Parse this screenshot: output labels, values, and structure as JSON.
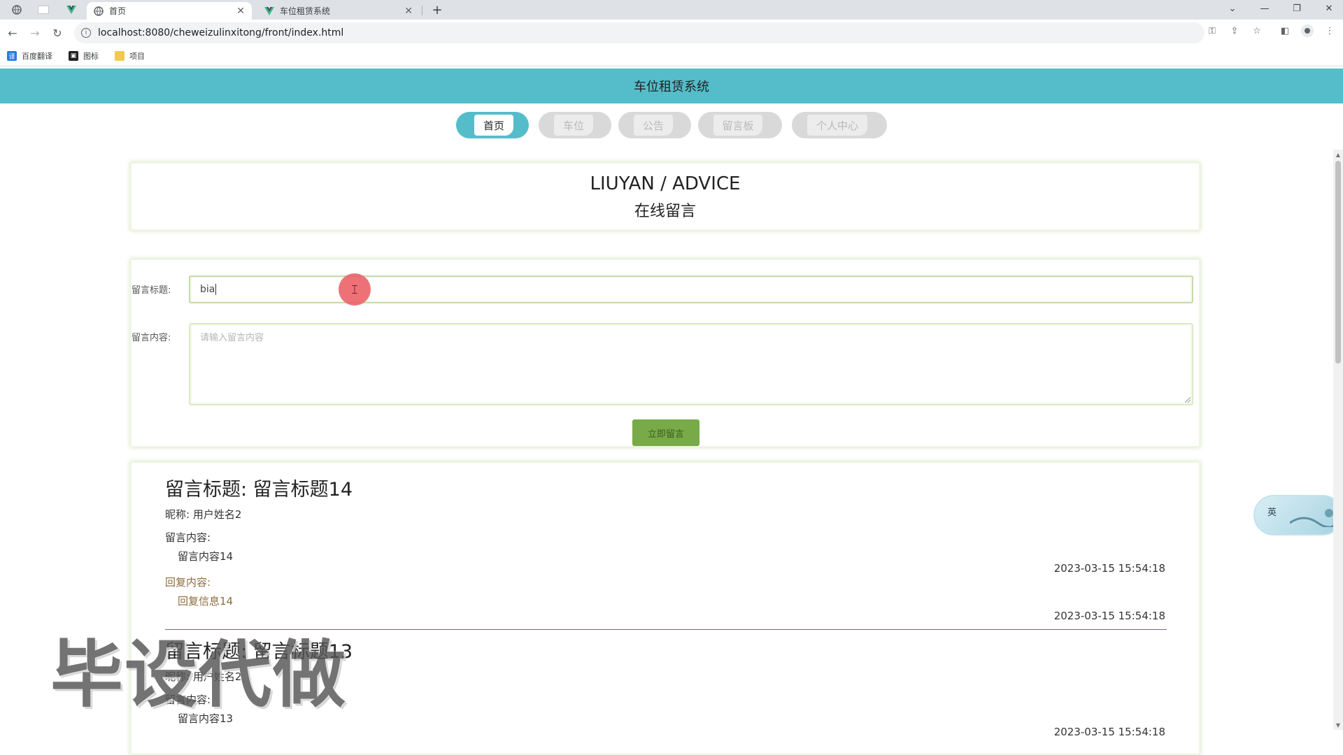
{
  "browser": {
    "tabs": [
      {
        "title": "首页",
        "active": true
      },
      {
        "title": "车位租赁系统",
        "active": false
      }
    ],
    "new_tab_label": "+",
    "url": "localhost:8080/cheweizulinxitong/front/index.html",
    "bookmarks": [
      {
        "label": "百度翻译",
        "icon": "translate-icon"
      },
      {
        "label": "图标",
        "icon": "image-icon"
      },
      {
        "label": "项目",
        "icon": "folder-icon"
      }
    ]
  },
  "site": {
    "title": "车位租赁系统",
    "nav": [
      {
        "label": "首页",
        "active": true
      },
      {
        "label": "车位",
        "active": false
      },
      {
        "label": "公告",
        "active": false
      },
      {
        "label": "留言板",
        "active": false
      },
      {
        "label": "个人中心",
        "active": false
      }
    ]
  },
  "section_header": {
    "en": "LIUYAN / ADVICE",
    "cn": "在线留言"
  },
  "form": {
    "title_label": "留言标题:",
    "title_value": "bia",
    "content_label": "留言内容:",
    "content_placeholder": "请输入留言内容",
    "submit_label": "立即留言"
  },
  "messages": [
    {
      "title": "留言标题:  留言标题14",
      "nickname": "昵称: 用户姓名2",
      "content_label": "留言内容:",
      "content": "留言内容14",
      "time": "2023-03-15 15:54:18",
      "reply_label": "回复内容:",
      "reply": "回复信息14",
      "reply_time": "2023-03-15 15:54:18"
    },
    {
      "title": "留言标题:  留言标题13",
      "nickname": "昵称: 用户姓名2",
      "content_label": "留言内容:",
      "content": "留言内容13",
      "time": "2023-03-15 15:54:18"
    }
  ],
  "watermark": "毕设代做",
  "ime": {
    "label": "英"
  },
  "colors": {
    "header": "#55bdca",
    "submit": "#78ab48",
    "reply": "#8e6c3c"
  }
}
